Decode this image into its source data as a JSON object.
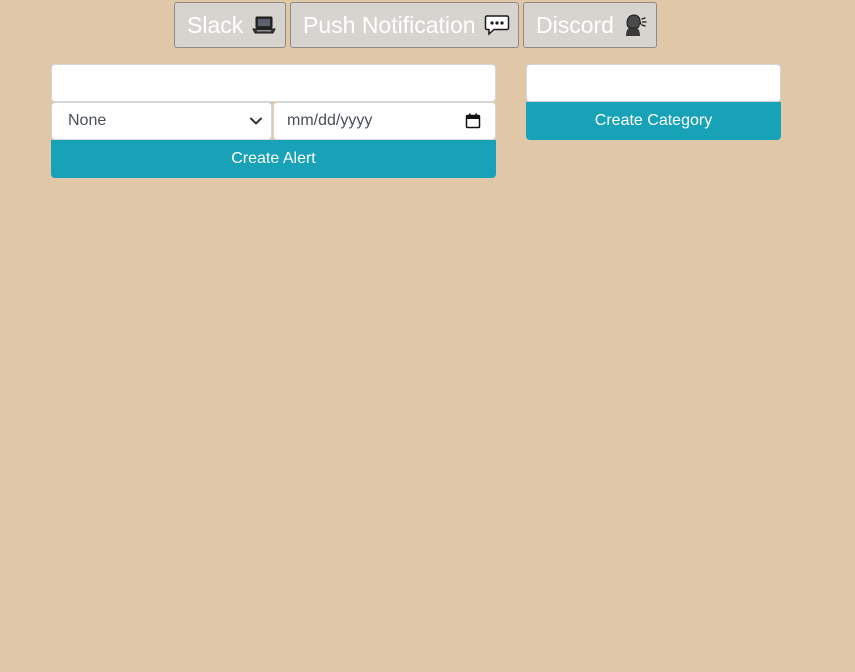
{
  "channels": [
    {
      "label": "Slack",
      "icon": "laptop-icon"
    },
    {
      "label": "Push Notification",
      "icon": "speech-bubble-icon"
    },
    {
      "label": "Discord",
      "icon": "speaking-head-icon"
    }
  ],
  "alert_form": {
    "text_value": "",
    "select_value": "None",
    "date_placeholder": "mm/dd/yyyy",
    "submit_label": "Create Alert"
  },
  "category_form": {
    "text_value": "",
    "submit_label": "Create Category"
  },
  "colors": {
    "background": "#dfc7a7",
    "accent": "#17a2b8",
    "channel_button_bg": "#d7d3cf"
  }
}
